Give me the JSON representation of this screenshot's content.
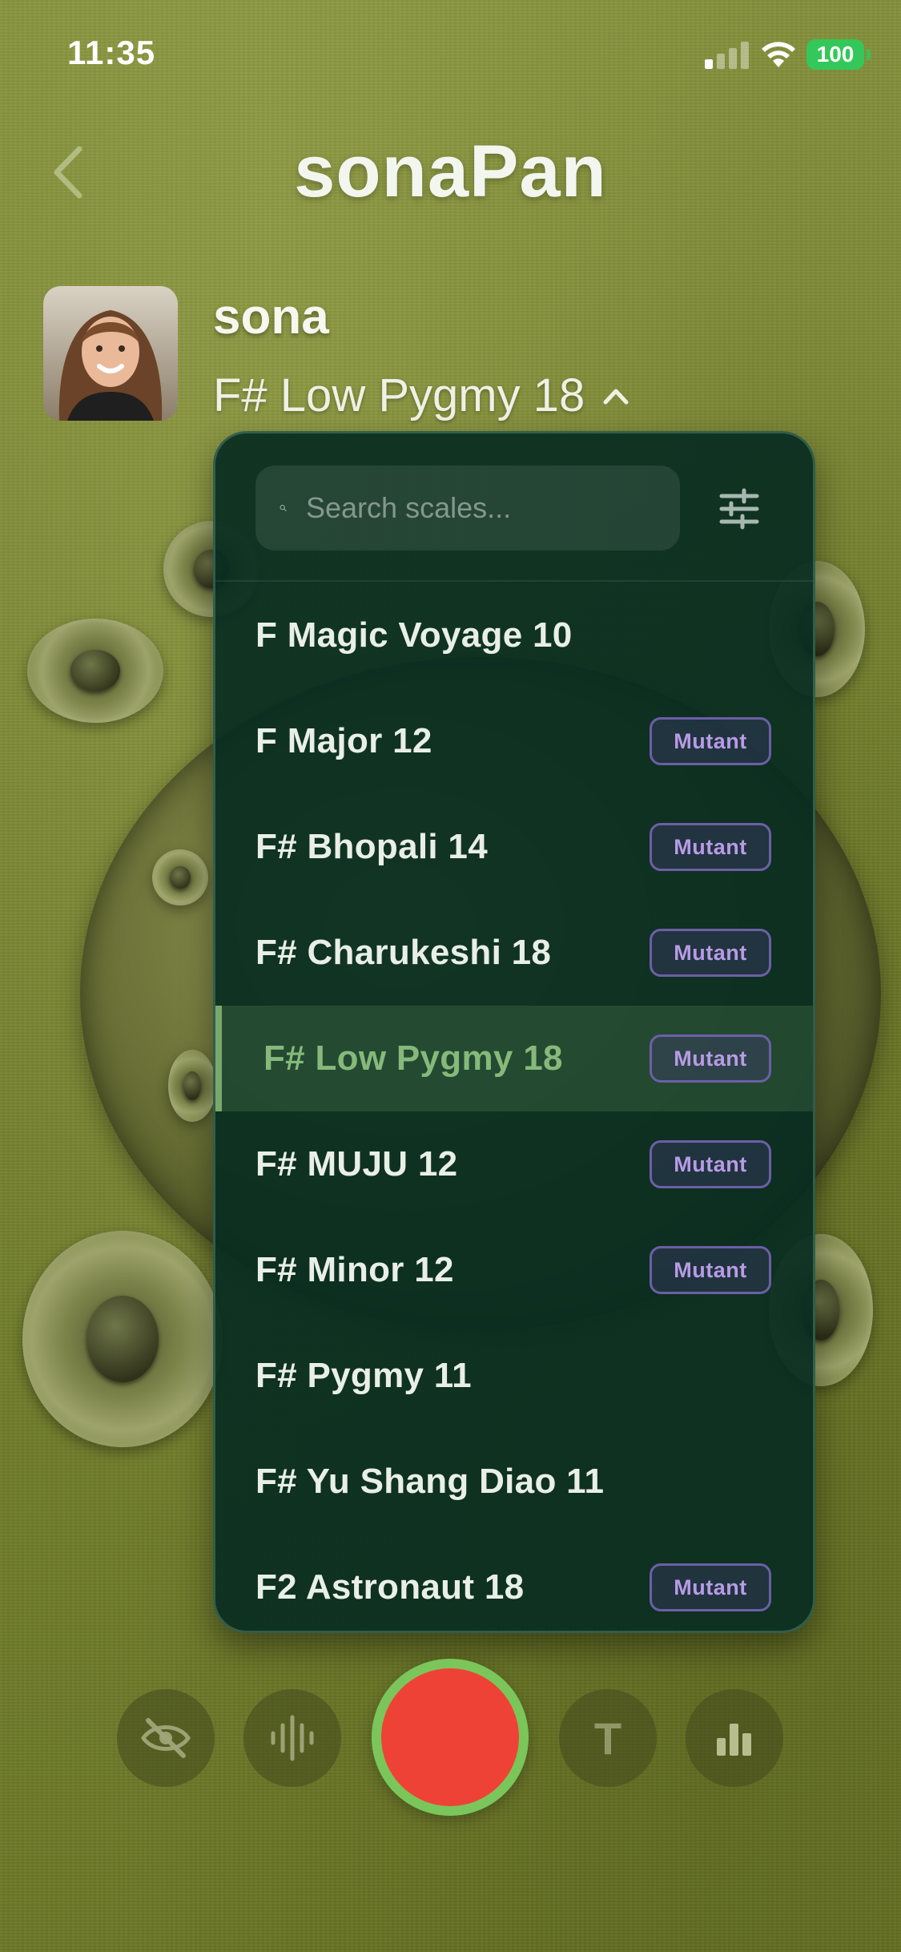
{
  "status_bar": {
    "time": "11:35",
    "battery": "100"
  },
  "header": {
    "title": "sonaPan"
  },
  "profile": {
    "username": "sona",
    "current_scale": "F# Low Pygmy 18"
  },
  "dropdown": {
    "search_placeholder": "Search scales...",
    "items": [
      {
        "name": "F Magic Voyage 10",
        "badge": ""
      },
      {
        "name": "F Major 12",
        "badge": "Mutant"
      },
      {
        "name": "F# Bhopali 14",
        "badge": "Mutant"
      },
      {
        "name": "F# Charukeshi 18",
        "badge": "Mutant"
      },
      {
        "name": "F# Low Pygmy 18",
        "badge": "Mutant",
        "selected": true
      },
      {
        "name": "F# MUJU 12",
        "badge": "Mutant"
      },
      {
        "name": "F# Minor 12",
        "badge": "Mutant"
      },
      {
        "name": "F# Pygmy 11",
        "badge": ""
      },
      {
        "name": "F# Yu Shang Diao 11",
        "badge": ""
      },
      {
        "name": "F2 Astronaut 18",
        "badge": "Mutant"
      }
    ]
  },
  "controls": {
    "visibility_icon": "eye-slash-icon",
    "waveform_icon": "waveform-icon",
    "text_icon": "T",
    "stats_icon": "bar-chart-icon"
  },
  "colors": {
    "background": "#7a8633",
    "panel": "#072c20",
    "selected_accent": "#78a86c",
    "badge_text": "#b89be6",
    "badge_border": "#6c5fa6",
    "record_red": "#ef4236",
    "record_ring": "#7ac65a",
    "battery_green": "#34c759"
  }
}
